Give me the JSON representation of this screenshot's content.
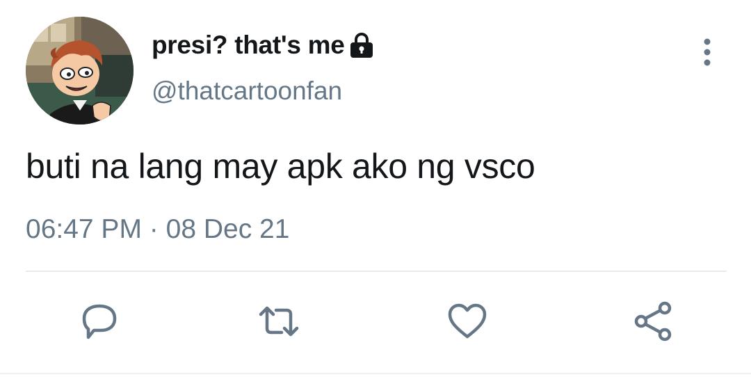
{
  "tweet": {
    "display_name": "presi? that's me",
    "handle": "@thatcartoonfan",
    "text": "buti na lang may apk ako ng vsco",
    "time": "06:47 PM",
    "separator": "·",
    "date": "08 Dec 21",
    "protected": true,
    "avatar_icon": "cartoon-boy-avatar"
  },
  "actions": {
    "reply_icon": "speech-bubble-icon",
    "retweet_icon": "retweet-arrows-icon",
    "like_icon": "heart-icon",
    "share_icon": "share-nodes-icon",
    "more_icon": "vertical-ellipsis-icon"
  },
  "colors": {
    "text": "#14171a",
    "secondary": "#657786",
    "divider": "#e6ecf0",
    "background": "#ffffff"
  }
}
